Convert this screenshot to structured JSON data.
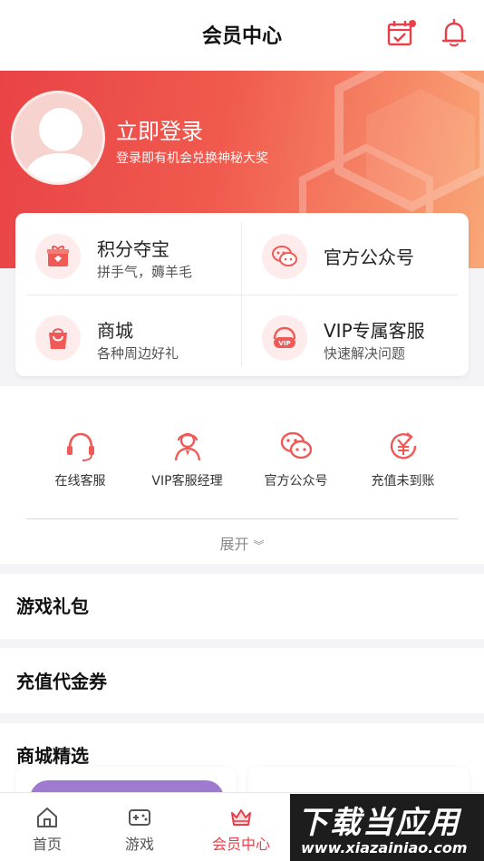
{
  "header": {
    "title": "会员中心",
    "icons": [
      "calendar-check-icon",
      "bell-icon"
    ]
  },
  "hero": {
    "login_title": "立即登录",
    "login_subtitle": "登录即有机会兑换神秘大奖"
  },
  "services": [
    {
      "title": "积分夺宝",
      "subtitle": "拼手气，薅羊毛",
      "icon": "gift-box-icon"
    },
    {
      "title": "官方公众号",
      "subtitle": "",
      "icon": "wechat-icon"
    },
    {
      "title": "商城",
      "subtitle": "各种周边好礼",
      "icon": "shopping-bag-icon"
    },
    {
      "title": "VIP专属客服",
      "subtitle": "快速解决问题",
      "icon": "vip-headset-icon"
    }
  ],
  "quick_services": [
    {
      "label": "在线客服",
      "icon": "headset-icon"
    },
    {
      "label": "VIP客服经理",
      "icon": "agent-icon"
    },
    {
      "label": "官方公众号",
      "icon": "wechat-icon"
    },
    {
      "label": "充值未到账",
      "icon": "yuan-refresh-icon"
    }
  ],
  "expand_label": "展开",
  "sections": {
    "game_gift": "游戏礼包",
    "voucher": "充值代金券",
    "shop_selection": "商城精选"
  },
  "tabs": [
    {
      "label": "首页",
      "icon": "home-icon",
      "active": false
    },
    {
      "label": "游戏",
      "icon": "gamepad-icon",
      "active": false
    },
    {
      "label": "会员中心",
      "icon": "crown-icon",
      "active": true
    }
  ],
  "watermark": {
    "big": "下载当应用",
    "small": "www.xiazainiao.com"
  },
  "colors": {
    "accent": "#e8404a",
    "hero_start": "#e94346",
    "hero_end": "#f9a777"
  }
}
